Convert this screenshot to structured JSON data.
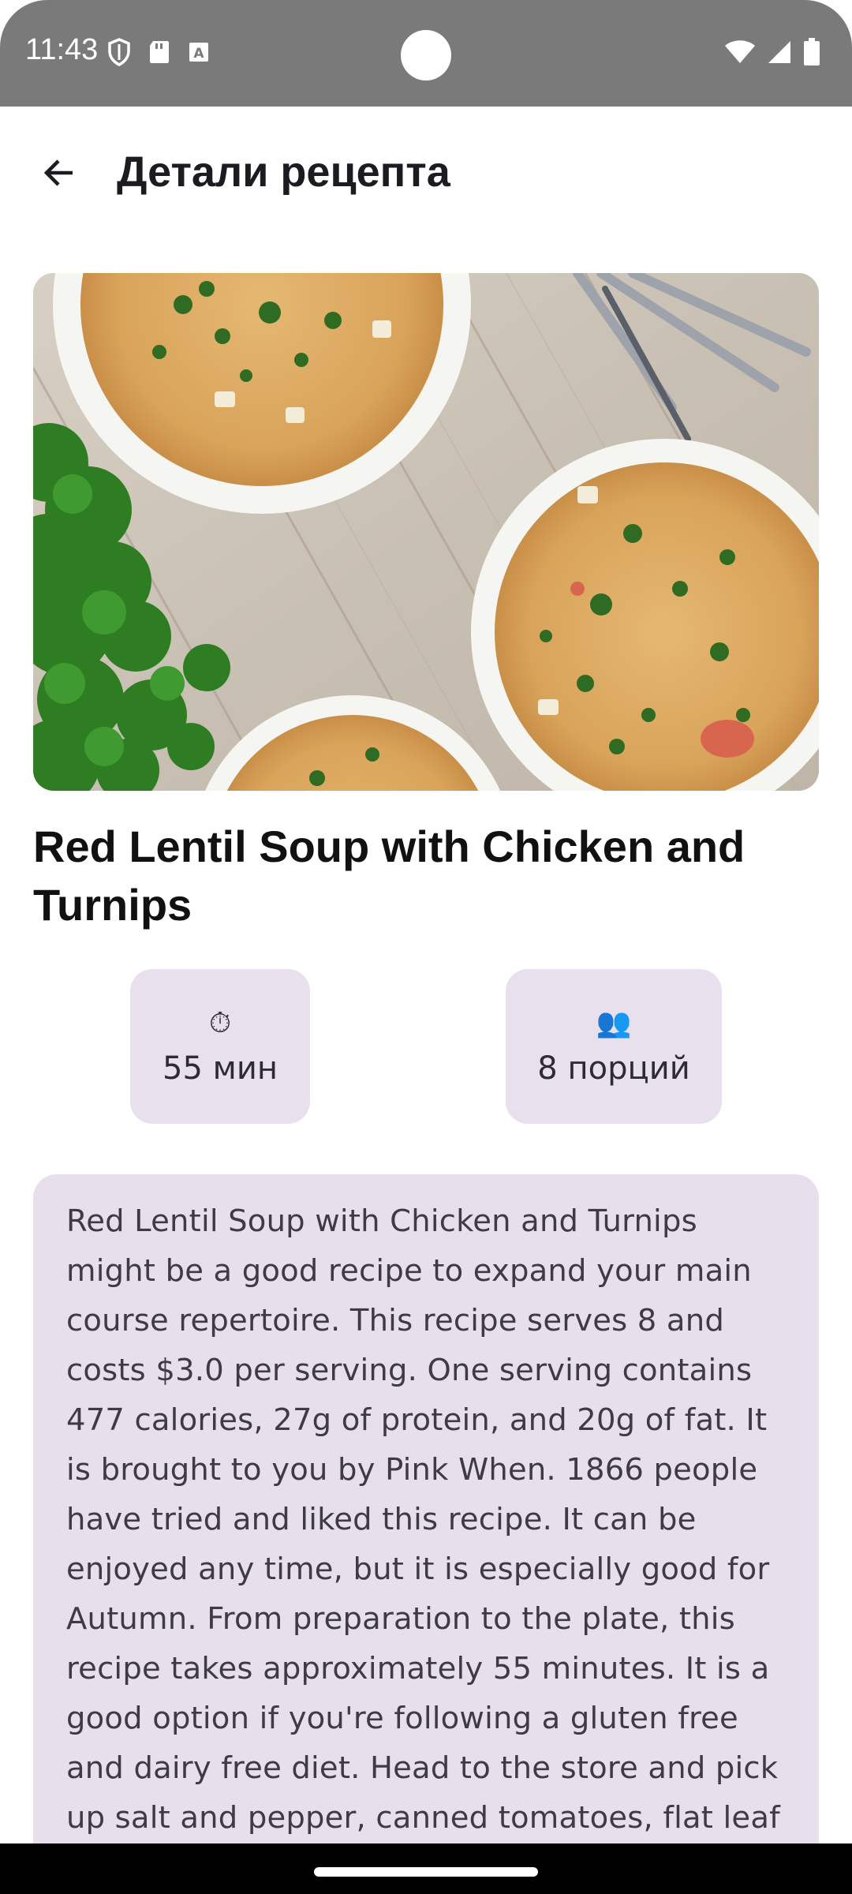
{
  "status_bar": {
    "time": "11:43",
    "icons_left": [
      "shield-icon",
      "sd-card-icon",
      "text-input-icon"
    ],
    "icons_right": [
      "wifi-icon",
      "signal-icon",
      "battery-icon"
    ]
  },
  "appbar": {
    "title": "Детали рецепта",
    "back_icon": "arrow-back-icon"
  },
  "recipe": {
    "image": "lentil-soup-photo",
    "title": "Red Lentil Soup with Chicken and Turnips",
    "time_icon": "⏱",
    "time_label": "55 мин",
    "servings_icon": "👥",
    "servings_label": "8 порций",
    "description": "Red Lentil Soup with Chicken and Turnips might be a good recipe to expand your main course repertoire. This recipe serves 8 and costs $3.0 per serving. One serving contains 477 calories, 27g of protein, and 20g of fat. It is brought to you by Pink When. 1866 people have tried and liked this recipe. It can be enjoyed any time, but it is especially good for Autumn. From preparation to the plate, this recipe takes approximately 55 minutes. It is a good option if you're following a gluten free and dairy free diet. Head to the store and pick up salt and pepper, canned tomatoes, flat leaf"
  },
  "colors": {
    "status_bar_bg": "#7a7a7a",
    "chip_bg": "#e8e0ec",
    "card_bg": "#e7e0ec",
    "title_text": "#1d1b20"
  }
}
